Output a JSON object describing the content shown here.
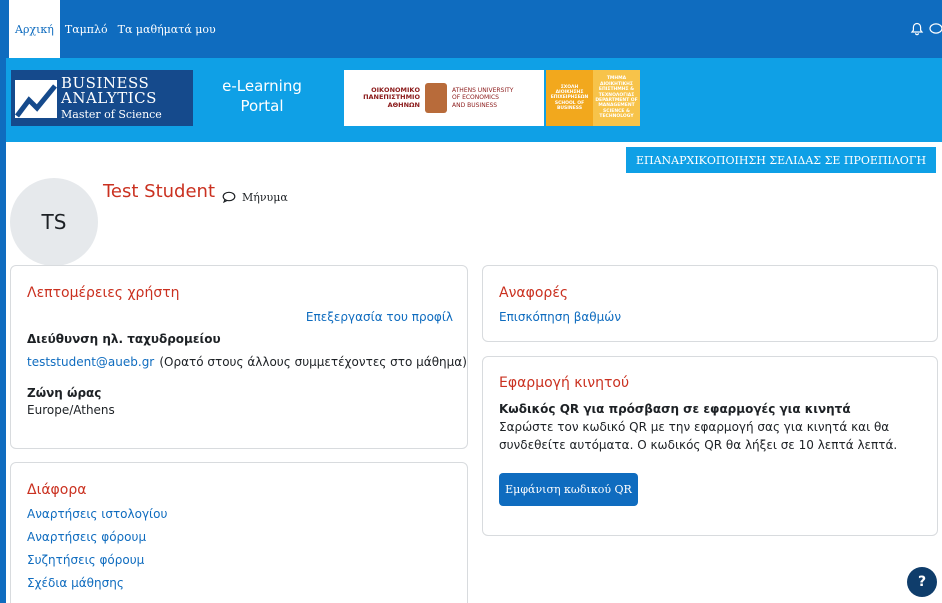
{
  "nav": {
    "items": [
      "Αρχική",
      "Ταμπλό",
      "Τα μαθήματά μου"
    ],
    "icons": [
      "bell-icon",
      "chat-icon"
    ]
  },
  "banner": {
    "ba_line1": "BUSINESS",
    "ba_line2": "ANALYTICS",
    "ba_line3": "Master of Science",
    "elearning_line1": "e-Learning",
    "elearning_line2": "Portal",
    "aueb_greek": [
      "ΟΙΚΟΝΟΜΙΚΟ",
      "ΠΑΝΕΠΙΣΤΗΜΙΟ",
      "ΑΘΗΝΩΝ"
    ],
    "aueb_english": [
      "ATHENS UNIVERSITY",
      "OF ECONOMICS",
      "AND BUSINESS"
    ],
    "dept_col1": [
      "ΣΧΟΛΗ",
      "ΔΙΟΙΚΗΣΗΣ",
      "ΕΠΙΧΕΙΡΗΣΕΩΝ",
      "SCHOOL OF",
      "BUSINESS"
    ],
    "dept_col2": [
      "ΤΜΗΜΑ",
      "ΔΙΟΙΚΗΤΙΚΗΣ",
      "ΕΠΙΣΤΗΜΗΣ &",
      "ΤΕΧΝΟΛΟΓΙΑΣ",
      "DEPARTMENT OF",
      "MANAGEMENT",
      "SCIENCE &",
      "TECHNOLOGY"
    ]
  },
  "reset_button": "ΕΠΑΝΑΡΧΙΚΟΠΟΙΗΣΗ ΣΕΛΙΔΑΣ ΣΕ ΠΡΟΕΠΙΛΟΓΗ",
  "profile": {
    "initials": "TS",
    "name": "Test Student",
    "message_label": "Μήνυμα"
  },
  "user_details": {
    "title": "Λεπτομέρειες χρήστη",
    "edit_link": "Επεξεργασία του προφίλ",
    "email_label": "Διεύθυνση ηλ. ταχυδρομείου",
    "email_value": "teststudent@aueb.gr",
    "email_visibility": "(Ορατό στους άλλους συμμετέχοντες στο μάθημα)",
    "timezone_label": "Ζώνη ώρας",
    "timezone_value": "Europe/Athens"
  },
  "reports": {
    "title": "Αναφορές",
    "grades_link": "Επισκόπηση βαθμών"
  },
  "mobile_app": {
    "title": "Εφαρμογή κινητού",
    "qr_heading": "Κωδικός QR για πρόσβαση σε εφαρμογές για κινητά",
    "qr_desc_line1": "Σαρώστε τον κωδικό QR με την εφαρμογή σας για κινητά και θα",
    "qr_desc_line2": "συνδεθείτε αυτόματα. Ο κωδικός QR θα λήξει σε 10 λεπτά λεπτά.",
    "qr_button": "Εμφάνιση κωδικού QR"
  },
  "misc": {
    "title": "Διάφορα",
    "links": [
      "Αναρτήσεις ιστολογίου",
      "Αναρτήσεις φόρουμ",
      "Συζητήσεις φόρουμ",
      "Σχέδια μάθησης"
    ]
  },
  "help_button": "?",
  "colors": {
    "primary": "#0f6cbf",
    "banner": "#0fa0e6",
    "title_red": "#ca3120"
  }
}
